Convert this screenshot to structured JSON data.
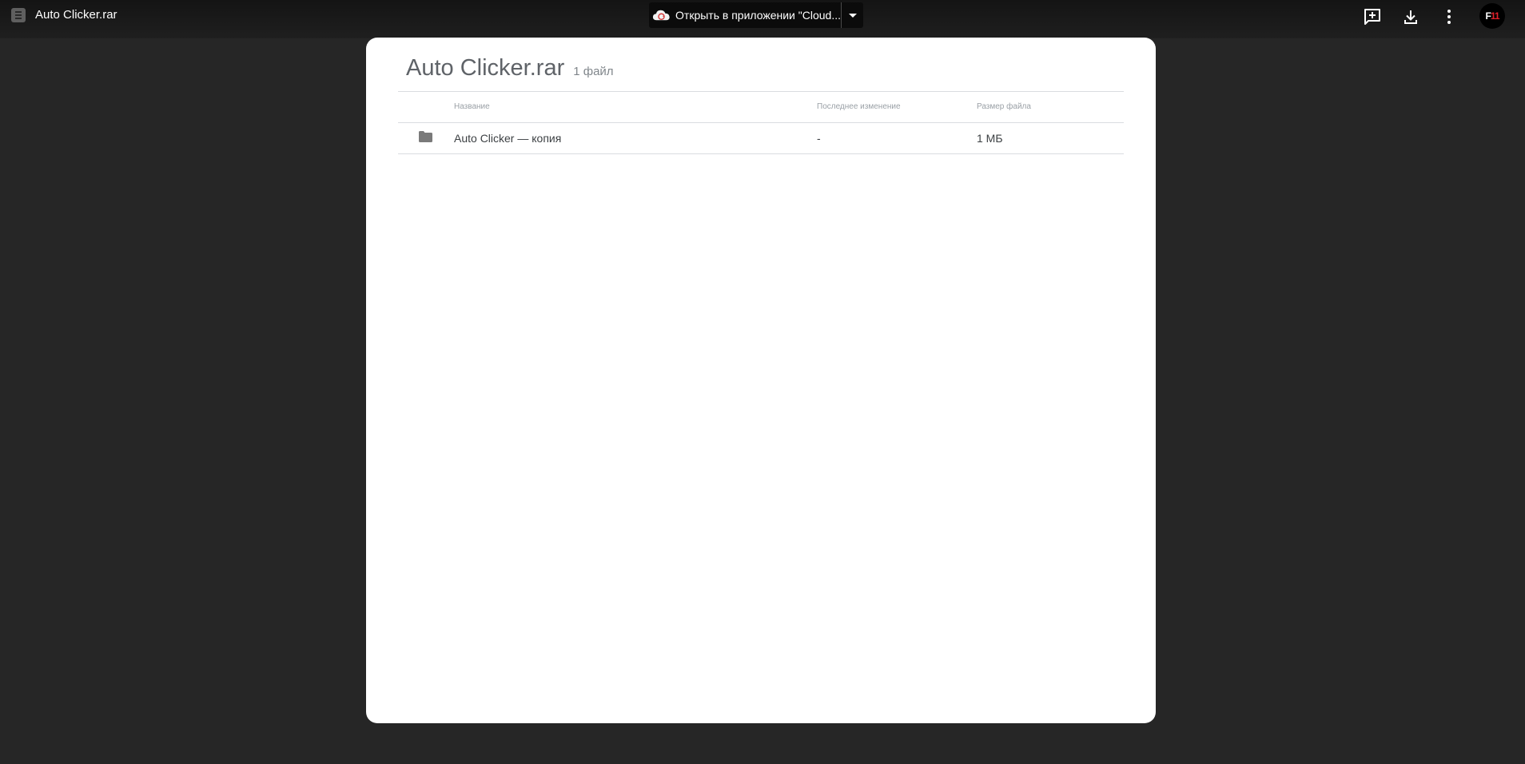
{
  "topbar": {
    "title": "Auto Clicker.rar",
    "open_with": {
      "label": "Открыть в приложении \"Cloud...",
      "icon": "cloud-convert-icon"
    },
    "actions": [
      {
        "name": "add-comment-icon"
      },
      {
        "name": "download-icon"
      },
      {
        "name": "more-options-icon"
      }
    ],
    "avatar": {
      "text_white": "F",
      "text_red": "11"
    }
  },
  "archive": {
    "title": "Auto Clicker.rar",
    "count": "1 файл",
    "columns": {
      "name": "Название",
      "modified": "Последнее изменение",
      "size": "Размер файла"
    },
    "rows": [
      {
        "name": "Auto Clicker — копия",
        "modified": "-",
        "size": "1 МБ",
        "icon": "folder-icon"
      }
    ]
  },
  "colors": {
    "background": "#262626",
    "card": "#ffffff",
    "avatar_accent": "#e0202a"
  }
}
